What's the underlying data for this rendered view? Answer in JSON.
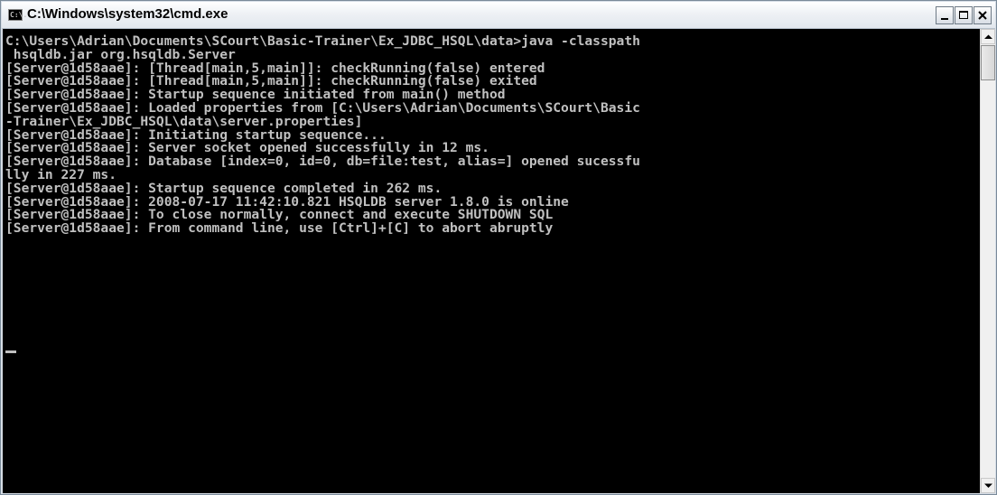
{
  "window": {
    "title": "C:\\Windows\\system32\\cmd.exe",
    "icon": "cmd-icon",
    "icon_glyph": "C:\\.",
    "buttons": [
      "minimize-icon",
      "maximize-icon",
      "close-icon"
    ]
  },
  "console": {
    "lines": [
      "C:\\Users\\Adrian\\Documents\\SCourt\\Basic-Trainer\\Ex_JDBC_HSQL\\data>java -classpath",
      " hsqldb.jar org.hsqldb.Server",
      "[Server@1d58aae]: [Thread[main,5,main]]: checkRunning(false) entered",
      "[Server@1d58aae]: [Thread[main,5,main]]: checkRunning(false) exited",
      "[Server@1d58aae]: Startup sequence initiated from main() method",
      "[Server@1d58aae]: Loaded properties from [C:\\Users\\Adrian\\Documents\\SCourt\\Basic",
      "-Trainer\\Ex_JDBC_HSQL\\data\\server.properties]",
      "[Server@1d58aae]: Initiating startup sequence...",
      "[Server@1d58aae]: Server socket opened successfully in 12 ms.",
      "[Server@1d58aae]: Database [index=0, id=0, db=file:test, alias=] opened sucessfu",
      "lly in 227 ms.",
      "[Server@1d58aae]: Startup sequence completed in 262 ms.",
      "[Server@1d58aae]: 2008-07-17 11:42:10.821 HSQLDB server 1.8.0 is online",
      "[Server@1d58aae]: To close normally, connect and execute SHUTDOWN SQL",
      "[Server@1d58aae]: From command line, use [Ctrl]+[C] to abort abruptly"
    ]
  },
  "colors": {
    "console_bg": "#000000",
    "console_fg": "#c0c0c0",
    "titlebar": "#e2e7ed"
  }
}
